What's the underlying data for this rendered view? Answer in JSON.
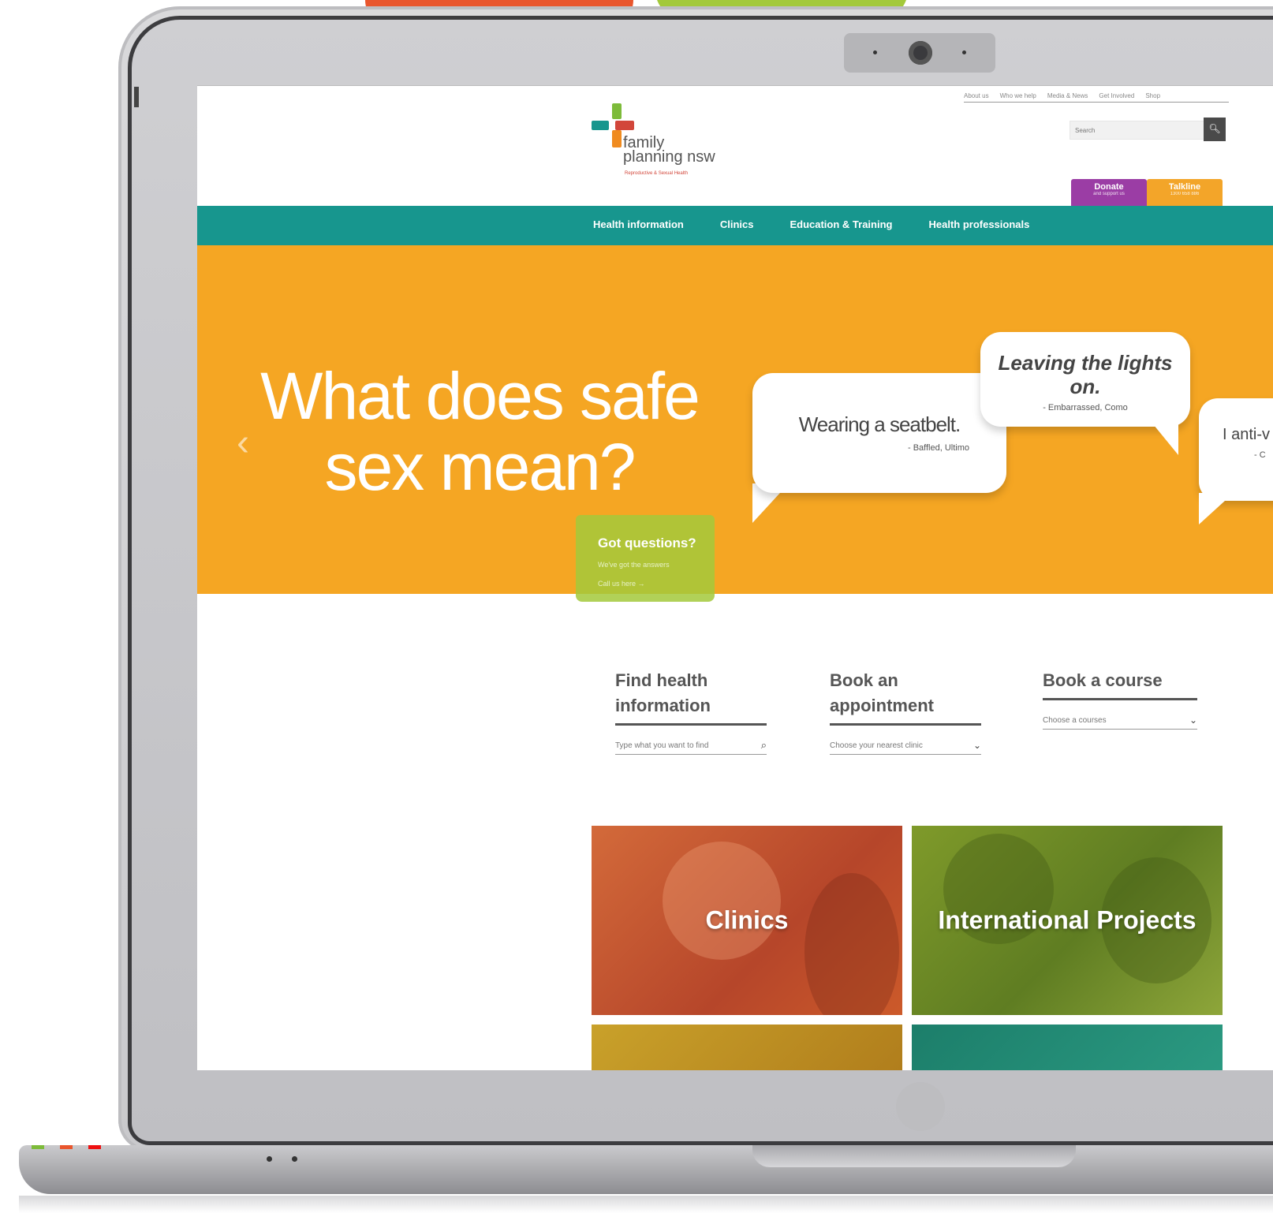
{
  "site": {
    "logo": {
      "line1": "family",
      "line2": "planning nsw",
      "tagline": "Reproductive & Sexual Health",
      "colors": {
        "teal": "#17968e",
        "orange": "#f08b1f",
        "red": "#d2463a",
        "green": "#7dbb3a"
      }
    },
    "top_links": [
      "About us",
      "Who we help",
      "Media & News",
      "Get Involved",
      "Shop"
    ],
    "search": {
      "placeholder": "Search",
      "icon": "search-icon"
    },
    "donate": {
      "label": "Donate",
      "sub": "and support us",
      "color": "#9b3da5"
    },
    "talkline": {
      "label": "Talkline",
      "sub": "1300 658 886",
      "color": "#f3a529"
    },
    "nav": [
      "Health information",
      "Clinics",
      "Education & Training",
      "Health professionals"
    ],
    "nav_color": "#17968e"
  },
  "hero": {
    "title": "What does safe sex mean?",
    "background": "#f5a623",
    "prev_icon": "chevron-left-icon",
    "bubbles": [
      {
        "quote": "Wearing a seatbelt.",
        "attribution": "- Baffled, Ultimo"
      },
      {
        "quote": "Leaving the lights on.",
        "attribution": "- Embarrassed, Como"
      },
      {
        "quote": "I anti-v",
        "attribution": "- C"
      }
    ]
  },
  "got_questions": {
    "title": "Got questions?",
    "subtitle": "We've got the answers",
    "link": "Call us here →"
  },
  "quick_actions": [
    {
      "title": "Find health information",
      "field": "Type what you want to find",
      "icon": "search-icon"
    },
    {
      "title": "Book an appointment",
      "field": "Choose your nearest clinic",
      "icon": "chevron-down-icon"
    },
    {
      "title": "Book a course",
      "field": "Choose a courses",
      "icon": "chevron-down-icon"
    }
  ],
  "tiles": [
    {
      "label": "Clinics",
      "color": "#c2512d"
    },
    {
      "label": "International Projects",
      "color": "#6f8d26"
    },
    {
      "label": "",
      "color": "#c9a12a"
    },
    {
      "label": "",
      "color": "#1c7e6a"
    }
  ]
}
